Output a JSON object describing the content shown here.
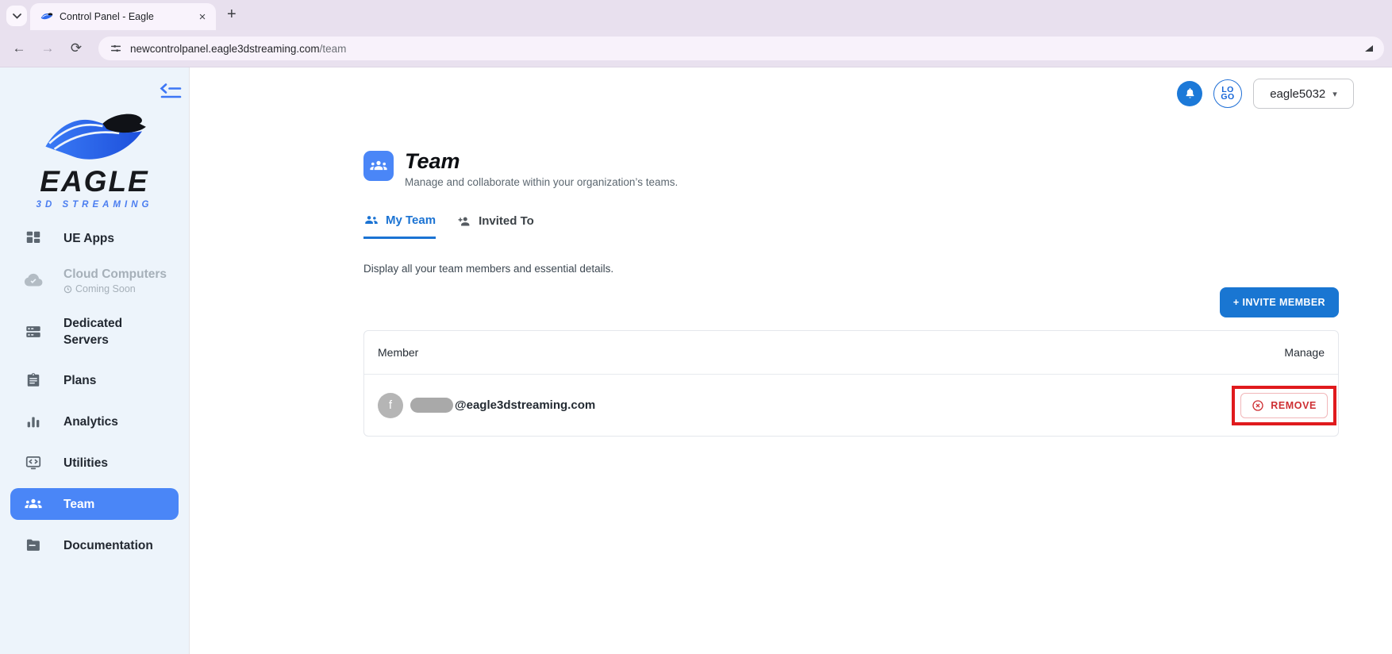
{
  "browser": {
    "tab_title": "Control Panel - Eagle",
    "close_tab": "×",
    "new_tab": "+",
    "back": "←",
    "forward": "→",
    "reload": "⟳",
    "url_host": "newcontrolpanel.eagle3dstreaming.com",
    "url_path": "/team"
  },
  "sidebar": {
    "brand": "EAGLE",
    "brand_sub": "3D STREAMING",
    "items": [
      {
        "label": "UE Apps"
      },
      {
        "label": "Cloud Computers",
        "sub": "Coming Soon"
      },
      {
        "label": "Dedicated Servers"
      },
      {
        "label": "Plans"
      },
      {
        "label": "Analytics"
      },
      {
        "label": "Utilities"
      },
      {
        "label": "Team"
      },
      {
        "label": "Documentation"
      }
    ]
  },
  "header": {
    "account_name": "eagle5032",
    "avatar_text_top": "LO",
    "avatar_text_bottom": "GO",
    "caret": "▾"
  },
  "page": {
    "title": "Team",
    "subtitle": "Manage and collaborate within your organization’s teams.",
    "tab_my_team": "My Team",
    "tab_invited_to": "Invited To",
    "description": "Display all your team members and essential details.",
    "invite_button": "+ INVITE MEMBER"
  },
  "table": {
    "col_member": "Member",
    "col_manage": "Manage",
    "row": {
      "avatar_initial": "f",
      "email_domain": "@eagle3dstreaming.com",
      "remove_label": "REMOVE"
    }
  },
  "colors": {
    "accent_blue": "#1976d2",
    "sidebar_active_blue": "#4a86f7",
    "sidebar_bg": "#edf4fb",
    "chrome_bg": "#e8e0ee",
    "remove_red": "#d32f2f",
    "annotation_red": "#e01a1d"
  }
}
